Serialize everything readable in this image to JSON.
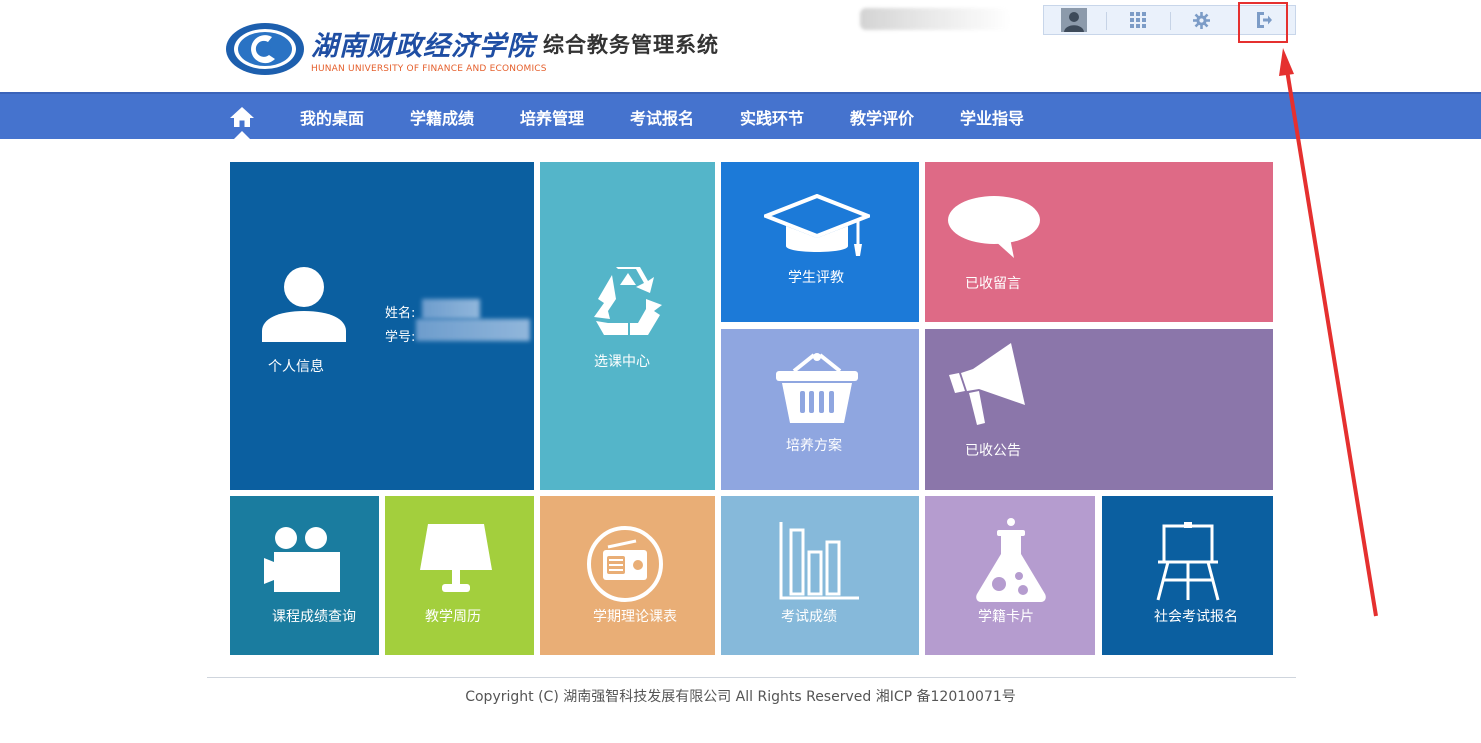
{
  "header": {
    "school_name_cn": "湖南财政经济学院",
    "system_name": "综合教务管理系统",
    "school_name_en": "HUNAN UNIVERSITY OF FINANCE AND ECONOMICS",
    "tools": [
      {
        "icon": "user-avatar-icon"
      },
      {
        "icon": "grid-icon"
      },
      {
        "icon": "gear-icon"
      },
      {
        "icon": "logout-icon"
      }
    ],
    "highlight_color": "#e5302f"
  },
  "nav": {
    "home_icon": "home-icon",
    "items": [
      {
        "label": "我的桌面"
      },
      {
        "label": "学籍成绩"
      },
      {
        "label": "培养管理"
      },
      {
        "label": "考试报名"
      },
      {
        "label": "实践环节"
      },
      {
        "label": "教学评价"
      },
      {
        "label": "学业指导"
      }
    ],
    "color": "#4573ce"
  },
  "tiles": {
    "personal": {
      "label": "个人信息",
      "name_label": "姓名:",
      "id_label": "学号:",
      "color": "#0b5fa0"
    },
    "course_select": {
      "label": "选课中心",
      "color": "#54b5c9"
    },
    "student_eval": {
      "label": "学生评教",
      "color": "#1c7ad8"
    },
    "messages": {
      "label": "已收留言",
      "color": "#de6a86"
    },
    "training_plan": {
      "label": "培养方案",
      "color": "#8fa6e0"
    },
    "notices": {
      "label": "已收公告",
      "color": "#8b76aa"
    },
    "grade_query": {
      "label": "课程成绩查询",
      "color": "#1a7c9f"
    },
    "calendar": {
      "label": "教学周历",
      "color": "#a3cf3d"
    },
    "timetable": {
      "label": "学期理论课表",
      "color": "#e9ae76"
    },
    "exam_scores": {
      "label": "考试成绩",
      "color": "#86b9da"
    },
    "status_card": {
      "label": "学籍卡片",
      "color": "#b59ccf"
    },
    "social_exam": {
      "label": "社会考试报名",
      "color": "#0b5fa0"
    }
  },
  "footer": {
    "copyright": "Copyright (C) 湖南强智科技发展有限公司 All Rights Reserved 湘ICP 备12010071号"
  }
}
